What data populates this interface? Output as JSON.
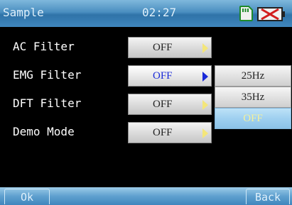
{
  "header": {
    "title": "Sample",
    "time": "02:27",
    "icons": [
      "sd-card-icon",
      "battery-empty-icon"
    ]
  },
  "rows": [
    {
      "label": "AC Filter",
      "value": "OFF"
    },
    {
      "label": "EMG Filter",
      "value": "OFF"
    },
    {
      "label": "DFT Filter",
      "value": "OFF"
    },
    {
      "label": "Demo Mode",
      "value": "OFF"
    }
  ],
  "dropdown": {
    "options": [
      "25Hz",
      "35Hz",
      "OFF"
    ],
    "selected": "OFF"
  },
  "footer": {
    "ok_label": "Ok",
    "back_label": "Back"
  },
  "colors": {
    "bar_blue": "#3f86bd",
    "active_value_blue": "#1a2ad8",
    "arrow_yellow": "#f4e67a",
    "selected_option_yellow": "#f6f09a",
    "sd_icon_green": "#1f8a2a",
    "battery_red": "#d21e1e"
  }
}
